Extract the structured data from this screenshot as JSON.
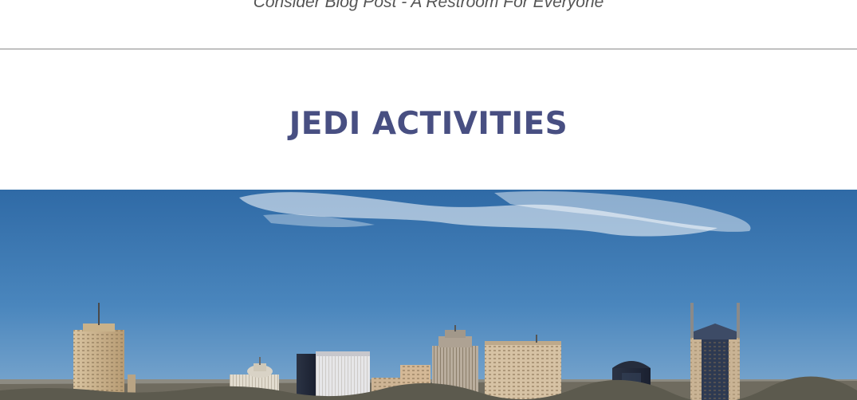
{
  "blog": {
    "link_text": "Consider Blog Post - A Restroom For Everyone"
  },
  "section": {
    "heading": "JEDI ACTIVITIES"
  },
  "hero": {
    "image_name": "nashville-skyline-photo"
  },
  "colors": {
    "heading": "#484f82",
    "sky_top": "#2f6aa6",
    "sky_bottom": "#7ea9cf",
    "divider": "#8a8a8a"
  }
}
